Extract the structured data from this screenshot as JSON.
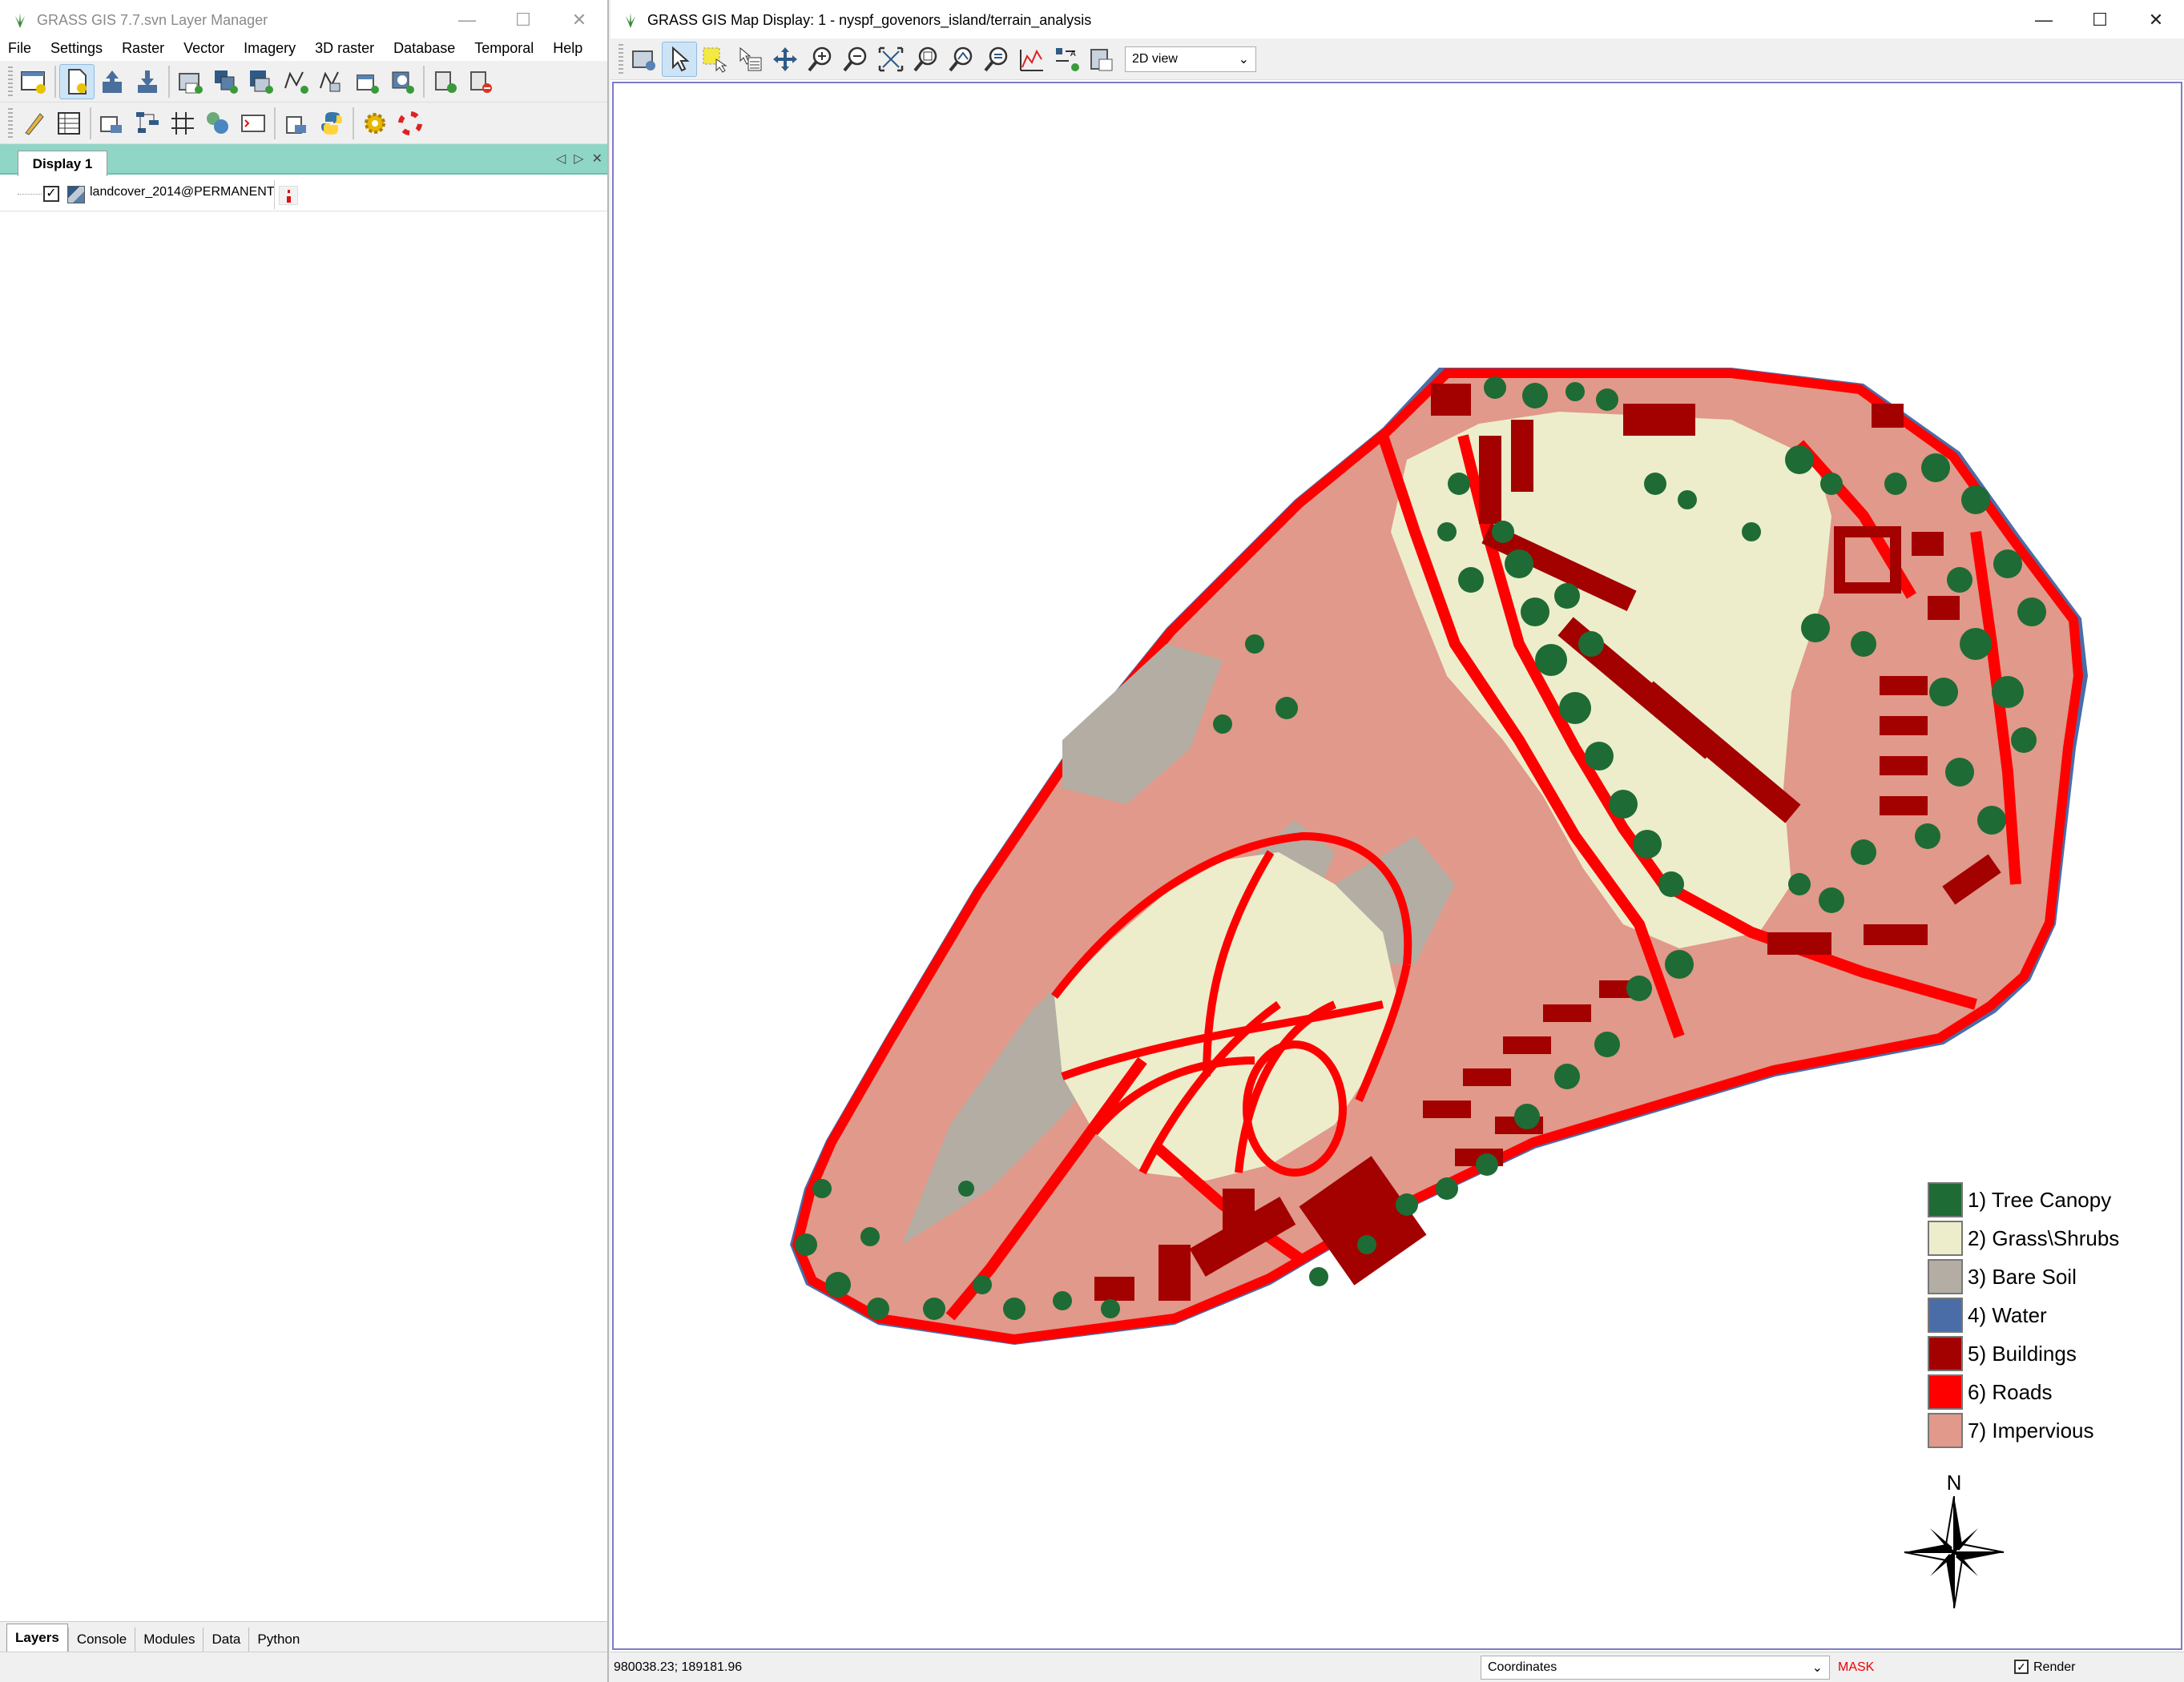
{
  "layer_manager": {
    "title": "GRASS GIS 7.7.svn Layer Manager",
    "menu": [
      "File",
      "Settings",
      "Raster",
      "Vector",
      "Imagery",
      "3D raster",
      "Database",
      "Temporal",
      "Help"
    ],
    "toolbar1_icons": [
      "new-display-icon",
      "new-workspace-icon",
      "open-workspace-icon",
      "save-workspace-icon",
      "add-raster-icon",
      "add-multiple-rasters-icon",
      "add-raster-misc-icon",
      "add-vector-icon",
      "add-vector-misc-icon",
      "add-overlay-icon",
      "add-group-icon",
      "add-grid-icon",
      "remove-layer-icon"
    ],
    "toolbar2_icons": [
      "digitizer-icon",
      "attribute-table-icon",
      "graphical-modeler-icon",
      "cartographic-composer-icon",
      "georectifier-icon",
      "animation-tool-icon",
      "cmd-line-icon",
      "python-icon",
      "settings-icon",
      "help-icon"
    ],
    "display_tab": "Display 1",
    "layer": {
      "name": "landcover_2014@PERMANENT",
      "checked": true
    },
    "bottom_tabs": [
      "Layers",
      "Console",
      "Modules",
      "Data",
      "Python"
    ],
    "active_bottom_tab": "Layers"
  },
  "map_display": {
    "title": "GRASS GIS Map Display: 1 - nyspf_govenors_island/terrain_analysis",
    "toolbar_icons": [
      "display-map-icon",
      "pointer-icon",
      "query-icon",
      "analyze-icon",
      "pan-icon",
      "zoom-in-icon",
      "zoom-out-icon",
      "zoom-back-icon",
      "zoom-extent-icon",
      "zoom-region-icon",
      "zoom-menu-icon",
      "analyze-map-icon",
      "overlay-icon",
      "save-image-icon"
    ],
    "view_mode": "2D view",
    "status": {
      "coordinates": "980038.23; 189181.96",
      "mode": "Coordinates",
      "mask": "MASK",
      "render": "Render",
      "render_checked": true
    }
  },
  "legend": {
    "entries": [
      {
        "label": "1) Tree Canopy",
        "color": "#1e6b35"
      },
      {
        "label": "2) Grass\\Shrubs",
        "color": "#ededcc"
      },
      {
        "label": "3) Bare Soil",
        "color": "#b3ada3"
      },
      {
        "label": "4) Water",
        "color": "#4a6da8"
      },
      {
        "label": "5) Buildings",
        "color": "#a30000"
      },
      {
        "label": "6) Roads",
        "color": "#ff0000"
      },
      {
        "label": "7) Impervious",
        "color": "#e0998a"
      }
    ]
  },
  "north_arrow": {
    "label": "N"
  }
}
